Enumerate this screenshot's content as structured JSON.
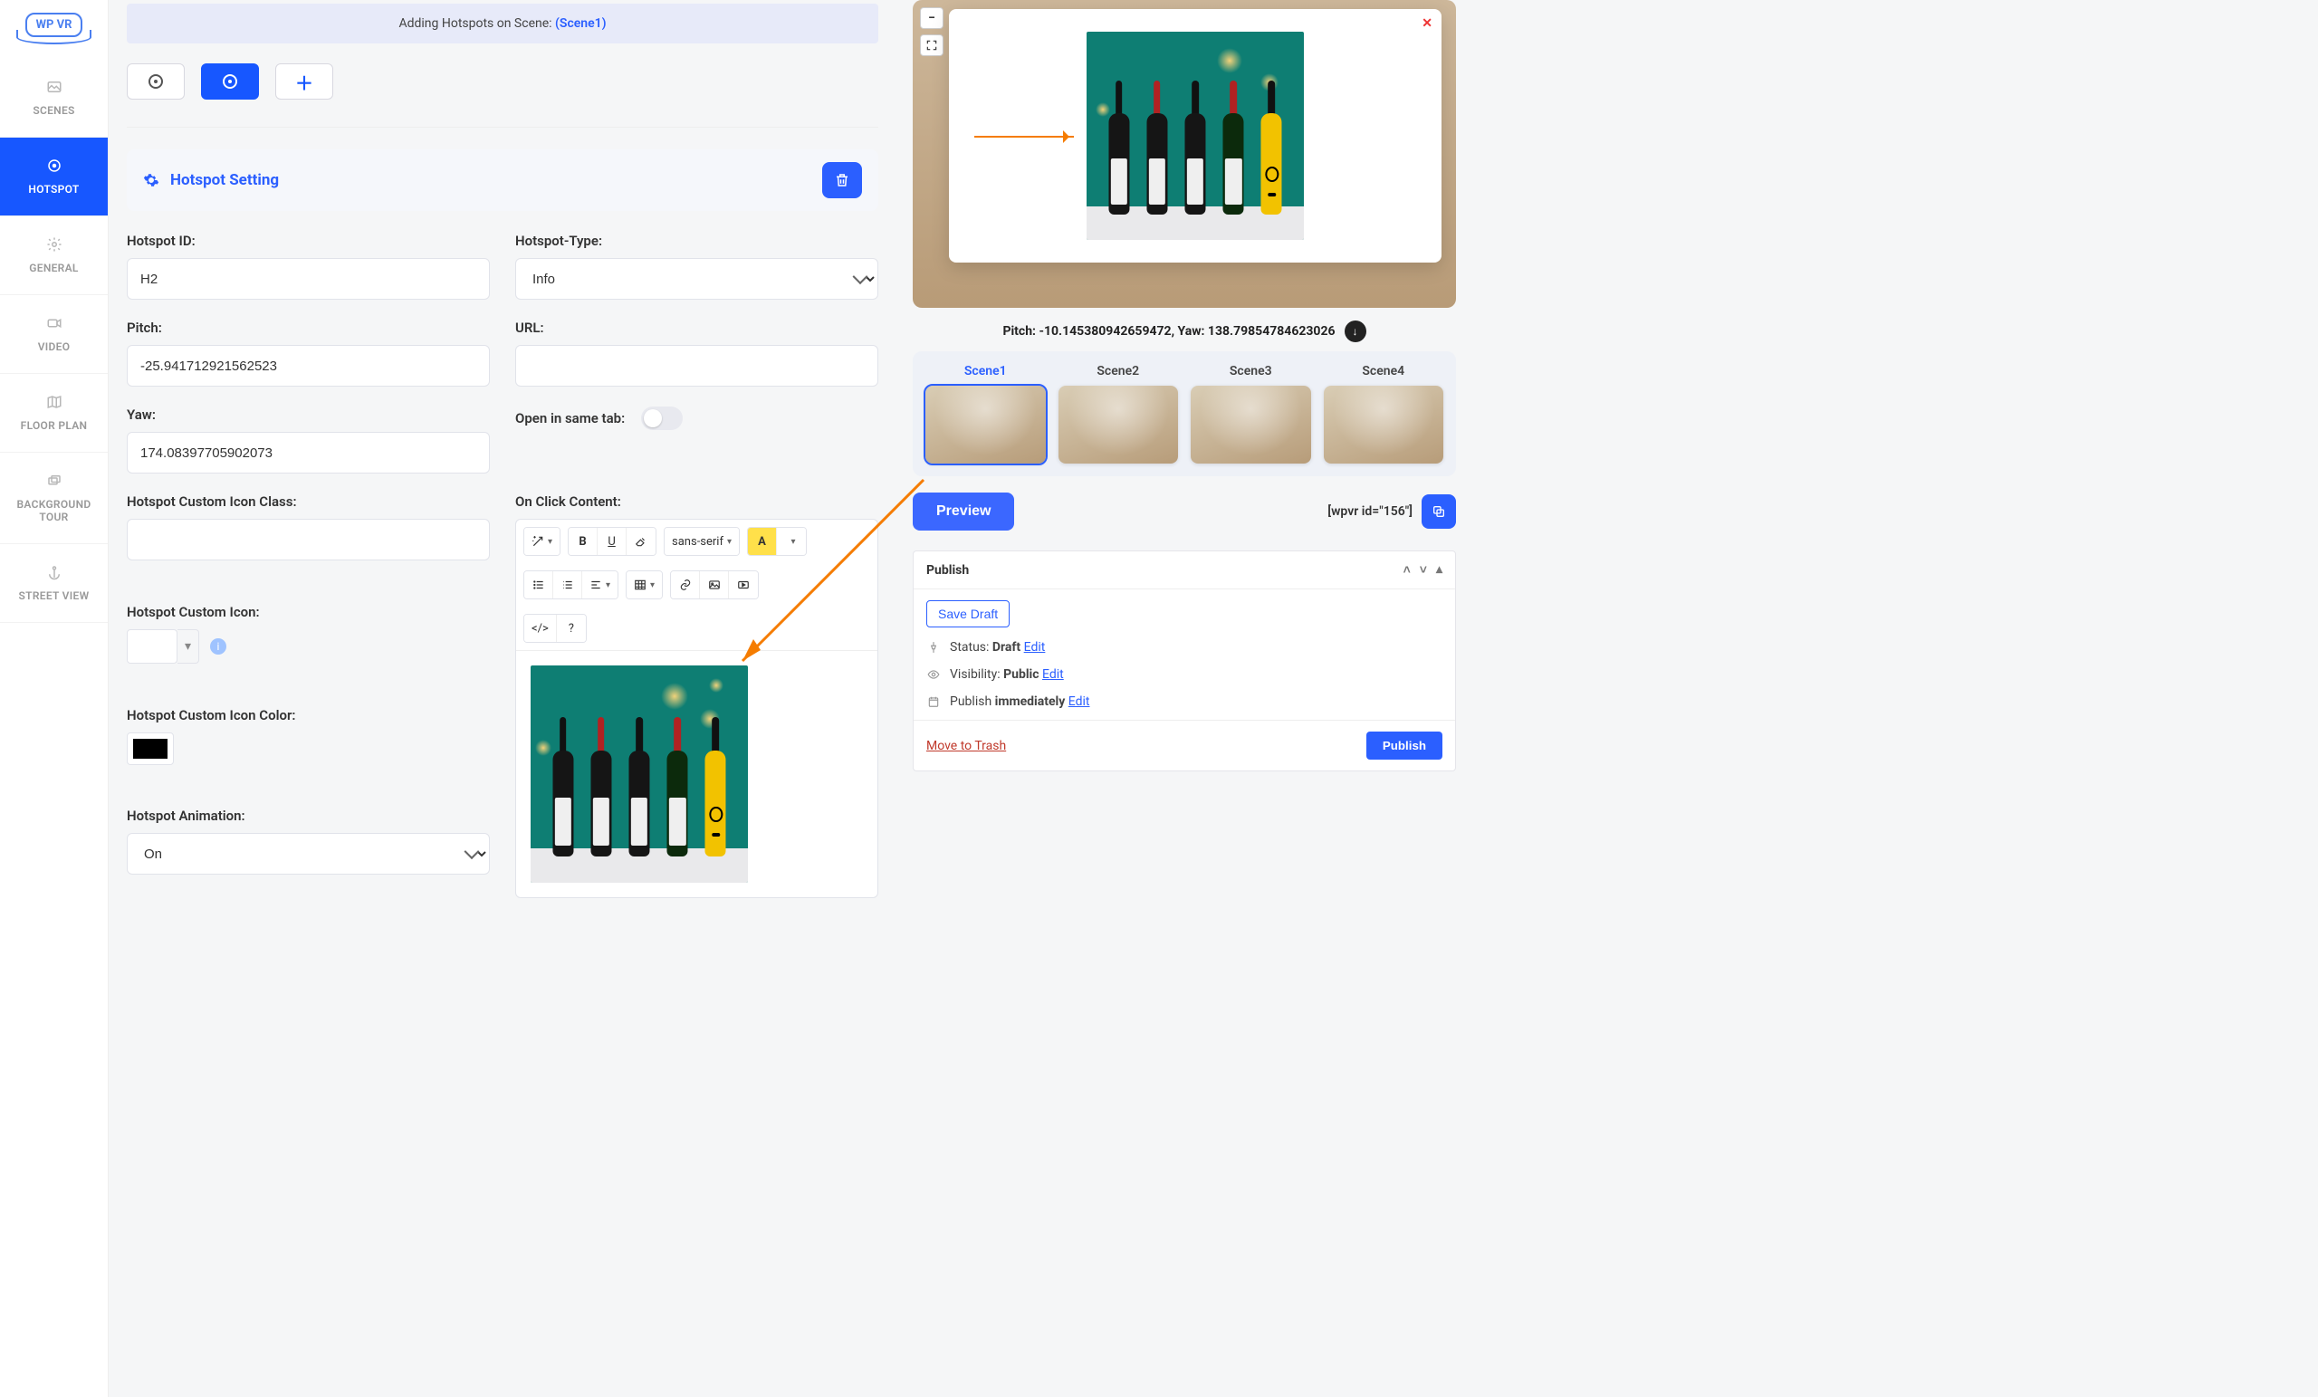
{
  "logo": "WP VR",
  "nav": [
    {
      "label": "SCENES"
    },
    {
      "label": "HOTSPOT"
    },
    {
      "label": "GENERAL"
    },
    {
      "label": "VIDEO"
    },
    {
      "label": "FLOOR PLAN"
    },
    {
      "label": "BACKGROUND TOUR"
    },
    {
      "label": "STREET VIEW"
    }
  ],
  "banner": {
    "prefix": "Adding Hotspots on Scene: ",
    "scene": "(Scene1)"
  },
  "panel_title": "Hotspot Setting",
  "fields": {
    "hotspot_id": {
      "label": "Hotspot ID:",
      "value": "H2"
    },
    "pitch": {
      "label": "Pitch:",
      "value": "-25.941712921562523"
    },
    "yaw": {
      "label": "Yaw:",
      "value": "174.08397705902073"
    },
    "icon_class": {
      "label": "Hotspot Custom Icon Class:",
      "value": ""
    },
    "icon": {
      "label": "Hotspot Custom Icon:"
    },
    "icon_color": {
      "label": "Hotspot Custom Icon Color:",
      "swatch": "#000000"
    },
    "animation": {
      "label": "Hotspot Animation:",
      "value": "On"
    },
    "type": {
      "label": "Hotspot-Type:",
      "value": "Info"
    },
    "url": {
      "label": "URL:",
      "value": ""
    },
    "same_tab": {
      "label": "Open in same tab:"
    },
    "on_click": {
      "label": "On Click Content:"
    }
  },
  "rte": {
    "font": "sans-serif",
    "btns": {
      "bold": "B",
      "underline": "U",
      "code": "</>",
      "help": "?"
    }
  },
  "preview": {
    "pitch_yaw": "Pitch: -10.145380942659472, Yaw: 138.79854784623026",
    "scenes": [
      "Scene1",
      "Scene2",
      "Scene3",
      "Scene4"
    ],
    "preview_btn": "Preview",
    "shortcode": "[wpvr id=\"156\"]"
  },
  "publish": {
    "title": "Publish",
    "save_draft": "Save Draft",
    "status_label": "Status: ",
    "status_value": "Draft",
    "visibility_label": "Visibility: ",
    "visibility_value": "Public",
    "schedule_prefix": "Publish ",
    "schedule_value": "immediately",
    "edit": "Edit",
    "trash": "Move to Trash",
    "publish_btn": "Publish"
  }
}
